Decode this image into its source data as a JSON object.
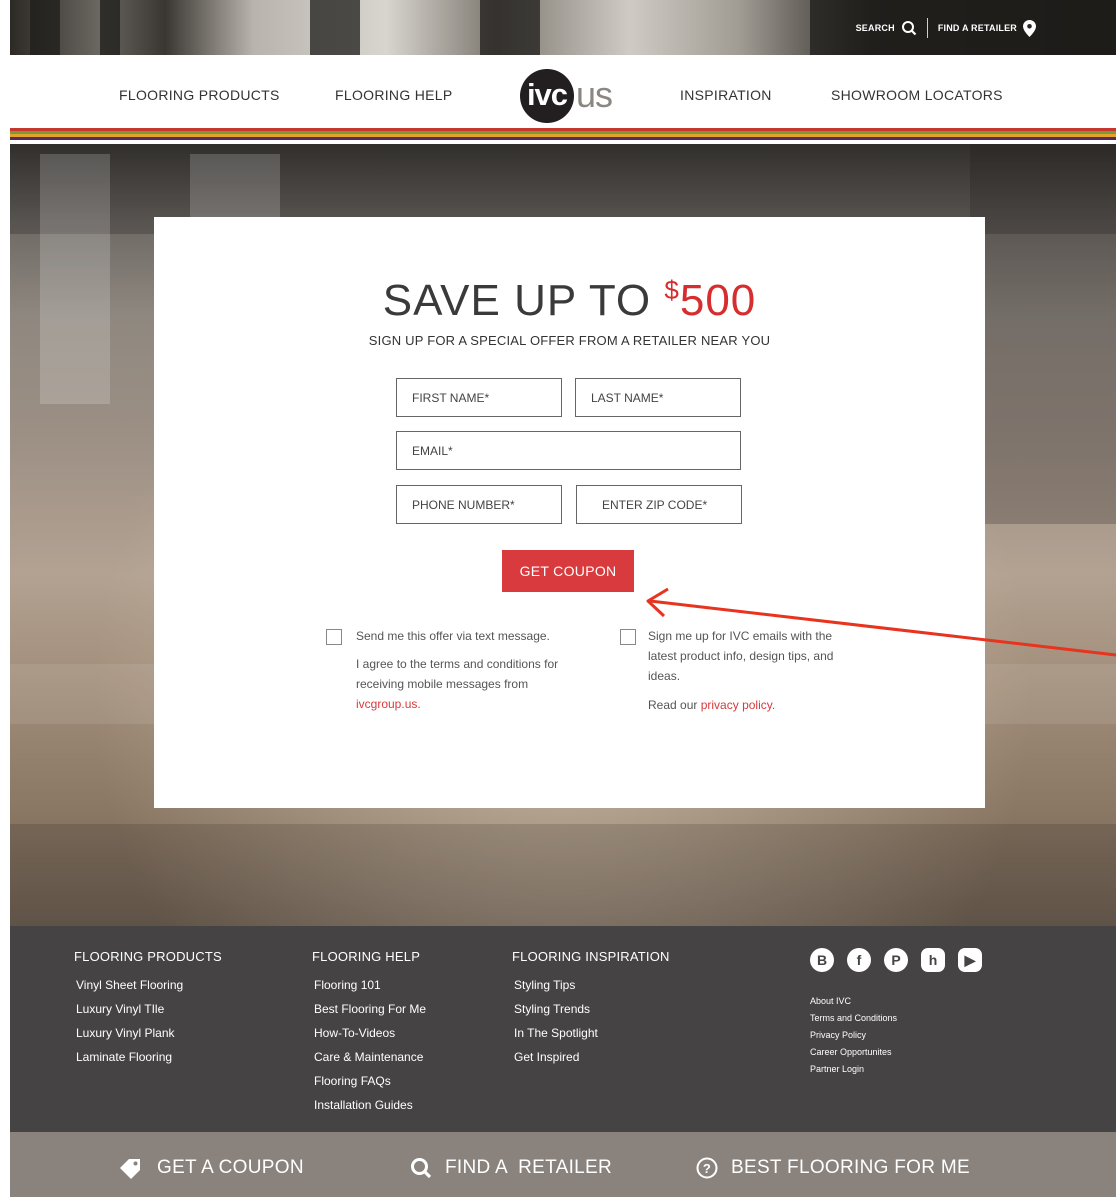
{
  "utility": {
    "search_label": "SEARCH",
    "retailer_label": "FIND A RETAILER"
  },
  "nav": {
    "items": [
      "FLOORING PRODUCTS",
      "FLOORING HELP",
      "INSPIRATION",
      "SHOWROOM LOCATORS"
    ],
    "logo_mark": "ivc",
    "logo_suffix": "us"
  },
  "stripe_colors": [
    "#c6362f",
    "#7a9a3a",
    "#e2a32b",
    "#5a2a5a"
  ],
  "offer": {
    "headline_prefix": "SAVE UP TO ",
    "headline_currency": "$",
    "headline_amount": "500",
    "subhead": "SIGN UP FOR A SPECIAL OFFER FROM A RETAILER NEAR YOU",
    "first_name_placeholder": "FIRST NAME*",
    "last_name_placeholder": "LAST NAME*",
    "email_placeholder": "EMAIL*",
    "phone_placeholder": "PHONE NUMBER*",
    "zip_placeholder": "ENTER ZIP CODE*",
    "button_label": "GET COUPON",
    "sms_option": {
      "label": "Send me this offer via text message.",
      "terms": "I agree to the terms and conditions for receiving mobile messages from",
      "link": "ivcgroup.us."
    },
    "email_option": {
      "label": "Sign me up for IVC emails with the latest product info, design tips, and ideas.",
      "privacy_prefix": "Read our",
      "privacy_link": "privacy policy."
    }
  },
  "footer": {
    "columns": [
      {
        "heading": "FLOORING PRODUCTS",
        "links": [
          "Vinyl Sheet Flooring",
          "Luxury Vinyl TIle",
          "Luxury Vinyl Plank",
          "Laminate Flooring"
        ]
      },
      {
        "heading": "FLOORING HELP",
        "links": [
          "Flooring 101",
          "Best Flooring For Me",
          "How-To-Videos",
          "Care & Maintenance",
          "Flooring FAQs",
          "Installation Guides"
        ]
      },
      {
        "heading": "FLOORING INSPIRATION",
        "links": [
          "Styling Tips",
          "Styling Trends",
          "In The Spotlight",
          "Get Inspired"
        ]
      }
    ],
    "social_icons": [
      "blogger-icon",
      "facebook-icon",
      "pinterest-icon",
      "houzz-icon",
      "youtube-icon"
    ],
    "legal_links": [
      "About IVC",
      "Terms and Conditions",
      "Privacy Policy",
      "Career Opportunites",
      "Partner Login"
    ]
  },
  "bottom_bar": {
    "coupon": "GET A COUPON",
    "retailer": "FIND A  RETAILER",
    "best": "BEST FLOORING FOR ME"
  },
  "accent_color": "#d83a3d"
}
